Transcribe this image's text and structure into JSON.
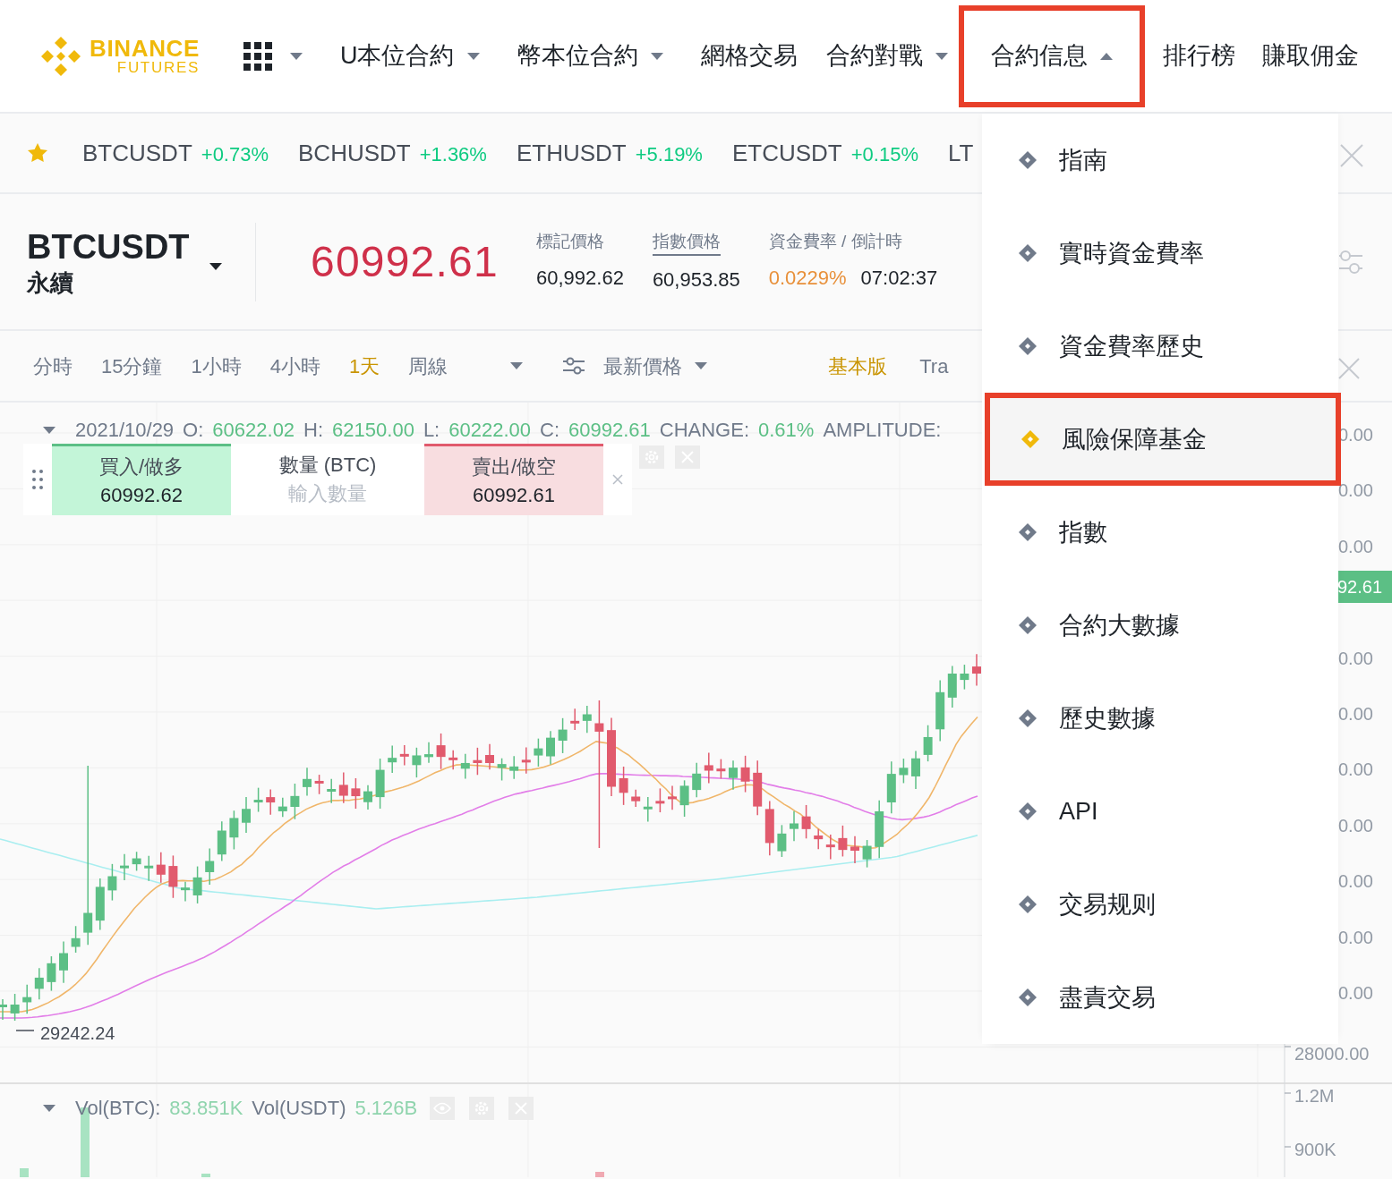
{
  "header": {
    "logo": {
      "brand": "BINANCE",
      "product": "FUTURES"
    },
    "nav": [
      {
        "label": "U本位合約",
        "has_menu": true,
        "expanded": false,
        "highlighted": false
      },
      {
        "label": "幣本位合約",
        "has_menu": true,
        "expanded": false,
        "highlighted": false
      },
      {
        "label": "網格交易",
        "has_menu": false,
        "highlighted": false
      },
      {
        "label": "合約對戰",
        "has_menu": true,
        "expanded": false,
        "highlighted": false
      },
      {
        "label": "合約信息",
        "has_menu": true,
        "expanded": true,
        "highlighted": true
      },
      {
        "label": "排行榜",
        "has_menu": false,
        "highlighted": false
      },
      {
        "label": "賺取佣金",
        "has_menu": false,
        "highlighted": false
      }
    ]
  },
  "ticker": [
    {
      "symbol": "BTCUSDT",
      "change": "+0.73%"
    },
    {
      "symbol": "BCHUSDT",
      "change": "+1.36%"
    },
    {
      "symbol": "ETHUSDT",
      "change": "+5.19%"
    },
    {
      "symbol": "ETCUSDT",
      "change": "+0.15%"
    },
    {
      "symbol": "LT"
    }
  ],
  "symbol": {
    "name": "BTCUSDT",
    "type": "永續",
    "last_price": "60992.61",
    "stats": [
      {
        "label": "標記價格",
        "value": "60,992.62",
        "underlined": false
      },
      {
        "label": "指數價格",
        "value": "60,953.85",
        "underlined": true
      },
      {
        "label": "資金費率 / 倒計時",
        "value": "0.0229%",
        "countdown": "07:02:37",
        "underlined": false
      }
    ]
  },
  "toolbar": {
    "intervals": [
      {
        "label": "分時",
        "selected": false
      },
      {
        "label": "15分鐘",
        "selected": false
      },
      {
        "label": "1小時",
        "selected": false
      },
      {
        "label": "4小時",
        "selected": false
      },
      {
        "label": "1天",
        "selected": true
      },
      {
        "label": "周線",
        "selected": false
      }
    ],
    "price_type": "最新價格",
    "views": [
      {
        "label": "基本版",
        "selected": true
      },
      {
        "label": "Tra",
        "selected": false
      }
    ]
  },
  "chart": {
    "legend": {
      "date": "2021/10/29",
      "fields": [
        {
          "label": "O:",
          "value": "60622.02"
        },
        {
          "label": "H:",
          "value": "62150.00"
        },
        {
          "label": "L:",
          "value": "60222.00"
        },
        {
          "label": "C:",
          "value": "60992.61"
        },
        {
          "label": "CHANGE:",
          "value": "0.61%"
        },
        {
          "label": "AMPLITUDE:"
        }
      ]
    },
    "order_panel": {
      "buy": {
        "label": "買入/做多",
        "price": "60992.62"
      },
      "quantity": {
        "label": "數量 (BTC)",
        "placeholder": "輸入數量"
      },
      "sell": {
        "label": "賣出/做空",
        "price": "60992.61"
      }
    },
    "low_marker": "29242.24",
    "axis_labels": [
      "0.00",
      "0.00",
      "0.00",
      "0.00",
      "0.00",
      "0.00",
      "0.00",
      "0.00",
      "0.00",
      "0.00",
      "28000.00"
    ],
    "price_tag": "92.61",
    "volume": {
      "fields": [
        {
          "label": "Vol(BTC):",
          "value": "83.851K"
        },
        {
          "label": "Vol(USDT)",
          "value": "5.126B"
        }
      ],
      "axis_labels": [
        "1.2M",
        "900K"
      ]
    }
  },
  "menu": {
    "items": [
      {
        "label": "指南",
        "selected": false,
        "highlighted": false
      },
      {
        "label": "實時資金費率",
        "selected": false,
        "highlighted": false
      },
      {
        "label": "資金費率歷史",
        "selected": false,
        "highlighted": false
      },
      {
        "label": "風險保障基金",
        "selected": true,
        "highlighted": true
      },
      {
        "label": "指數",
        "selected": false,
        "highlighted": false
      },
      {
        "label": "合約大數據",
        "selected": false,
        "highlighted": false
      },
      {
        "label": "歷史數據",
        "selected": false,
        "highlighted": false
      },
      {
        "label": "API",
        "selected": false,
        "highlighted": false
      },
      {
        "label": "交易规则",
        "selected": false,
        "highlighted": false
      },
      {
        "label": "盡責交易",
        "selected": false,
        "highlighted": false
      }
    ]
  }
}
